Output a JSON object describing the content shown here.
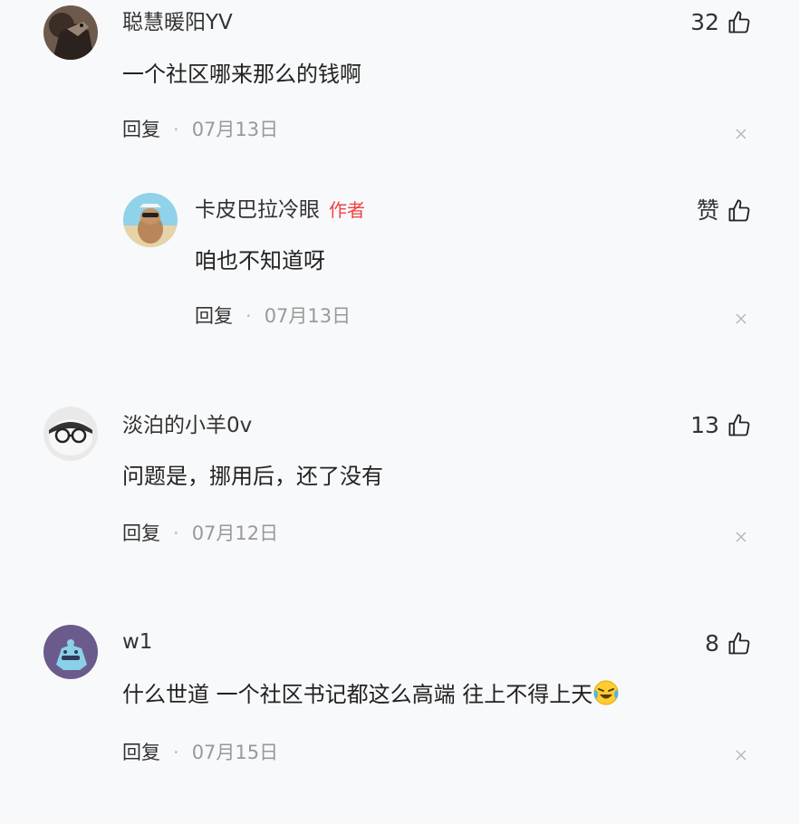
{
  "comments": [
    {
      "username": "聪慧暖阳YV",
      "content": "一个社区哪来那么的钱啊",
      "reply_label": "回复",
      "separator": "·",
      "date": "07月13日",
      "likes": "32"
    },
    {
      "username": "卡皮巴拉冷眼",
      "author_tag": "作者",
      "content": "咱也不知道呀",
      "reply_label": "回复",
      "separator": "·",
      "date": "07月13日",
      "likes": "赞"
    },
    {
      "username": "淡泊的小羊0v",
      "content": "问题是，挪用后，还了没有",
      "reply_label": "回复",
      "separator": "·",
      "date": "07月12日",
      "likes": "13"
    },
    {
      "username": "w1",
      "content": "什么世道 一个社区书记都这么高端 往上不得上天",
      "content_emoji": "laughing-crying-emoji",
      "reply_label": "回复",
      "separator": "·",
      "date": "07月15日",
      "likes": "8"
    }
  ],
  "colors": {
    "background": "#f8f9fb",
    "author_tag": "#f04142",
    "meta_text": "#999999"
  }
}
